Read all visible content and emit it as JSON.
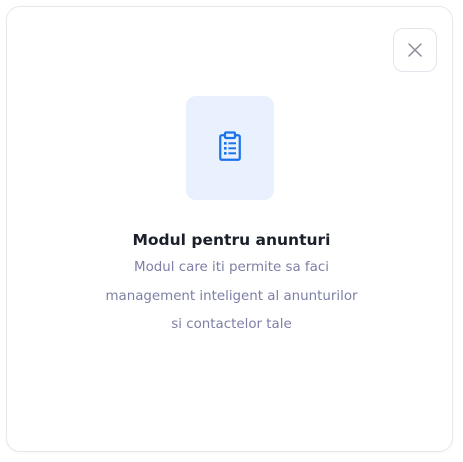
{
  "modal": {
    "close_icon": "close-icon",
    "module_icon": "clipboard-list-icon",
    "accent_color": "#1a73e8",
    "tile_color": "#e8f1fd",
    "title": "Modul pentru anunturi",
    "description_lines": [
      "Modul care iti permite sa faci",
      "management inteligent al anunturilor",
      "si contactelor tale"
    ]
  }
}
